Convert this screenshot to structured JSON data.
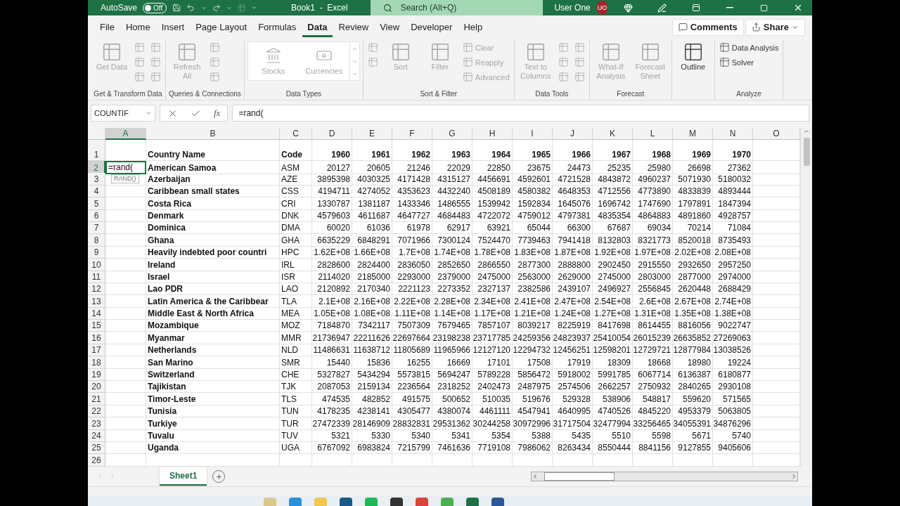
{
  "title_bar": {
    "autosave_label": "AutoSave",
    "autosave": {
      "label": "Off",
      "on": false
    },
    "title": "Book1  -  Excel",
    "search": {
      "placeholder": "Search (Alt+Q)"
    },
    "user": "User One",
    "avatar": "UO"
  },
  "menu_tabs": [
    {
      "label": "File",
      "selected": false
    },
    {
      "label": "Home",
      "selected": false
    },
    {
      "label": "Insert",
      "selected": false
    },
    {
      "label": "Page Layout",
      "selected": false
    },
    {
      "label": "Formulas",
      "selected": false
    },
    {
      "label": "Data",
      "selected": true
    },
    {
      "label": "Review",
      "selected": false
    },
    {
      "label": "View",
      "selected": false
    },
    {
      "label": "Developer",
      "selected": false
    },
    {
      "label": "Help",
      "selected": false
    }
  ],
  "comments_button": "Comments",
  "share_button": "Share",
  "ribbon": [
    {
      "name": "Get & Transform Data",
      "items": [
        {
          "kind": "large",
          "label": "Get Data",
          "disabled": true
        },
        {
          "kind": "small",
          "disabled": true
        },
        {
          "kind": "small",
          "disabled": true
        },
        {
          "kind": "small",
          "disabled": true
        },
        {
          "kind": "small",
          "disabled": true
        },
        {
          "kind": "small",
          "disabled": true
        },
        {
          "kind": "small",
          "disabled": true
        }
      ]
    },
    {
      "name": "Queries & Connections",
      "items": [
        {
          "kind": "large",
          "label": "Refresh All",
          "disabled": true
        },
        {
          "kind": "small",
          "disabled": true
        },
        {
          "kind": "small",
          "disabled": true
        },
        {
          "kind": "small",
          "disabled": true
        }
      ]
    },
    {
      "name": "Data Types",
      "items": [
        {
          "kind": "gallery",
          "options": [
            {
              "label": "Stocks",
              "disabled": true
            },
            {
              "label": "Currencies",
              "disabled": true
            }
          ]
        }
      ]
    },
    {
      "name": "Sort & Filter",
      "items": [
        {
          "kind": "small",
          "disabled": true
        },
        {
          "kind": "small",
          "disabled": true
        },
        {
          "kind": "large",
          "label": "Sort",
          "disabled": true
        },
        {
          "kind": "large",
          "label": "Filter",
          "disabled": true
        },
        {
          "kind": "small",
          "label": "Clear",
          "disabled": true
        },
        {
          "kind": "small",
          "label": "Reapply",
          "disabled": true
        },
        {
          "kind": "small",
          "label": "Advanced",
          "disabled": true
        }
      ]
    },
    {
      "name": "Data Tools",
      "items": [
        {
          "kind": "large",
          "label": "Text to Columns",
          "disabled": true
        },
        {
          "kind": "small",
          "disabled": true
        },
        {
          "kind": "small",
          "disabled": true
        },
        {
          "kind": "small",
          "disabled": true
        },
        {
          "kind": "small",
          "disabled": true
        },
        {
          "kind": "small",
          "disabled": true
        },
        {
          "kind": "small",
          "disabled": true
        }
      ]
    },
    {
      "name": "Forecast",
      "items": [
        {
          "kind": "large",
          "label": "What-If Analysis",
          "disabled": true
        },
        {
          "kind": "large",
          "label": "Forecast Sheet",
          "disabled": true
        }
      ]
    },
    {
      "items": [
        {
          "kind": "large",
          "label": "Outline",
          "disabled": false
        }
      ]
    },
    {
      "name": "Analyze",
      "items": [
        {
          "kind": "small",
          "label": "Data Analysis",
          "disabled": false
        },
        {
          "kind": "small",
          "label": "Solver",
          "disabled": false
        }
      ]
    }
  ],
  "formula_bar": {
    "name_box": "COUNTIF",
    "fx": "fx",
    "formula": "=rand("
  },
  "sheet": {
    "columns": [
      {
        "letter": "A",
        "selected": true
      },
      {
        "letter": "B",
        "selected": false
      },
      {
        "letter": "C",
        "selected": false
      },
      {
        "letter": "D",
        "selected": false
      },
      {
        "letter": "E",
        "selected": false
      },
      {
        "letter": "F",
        "selected": false
      },
      {
        "letter": "G",
        "selected": false
      },
      {
        "letter": "H",
        "selected": false
      },
      {
        "letter": "I",
        "selected": false
      },
      {
        "letter": "J",
        "selected": false
      },
      {
        "letter": "K",
        "selected": false
      },
      {
        "letter": "L",
        "selected": false
      },
      {
        "letter": "M",
        "selected": false
      },
      {
        "letter": "N",
        "selected": false
      },
      {
        "letter": "O",
        "selected": false
      }
    ],
    "header_row": {
      "number": "1",
      "selected": false,
      "name": "Country Name",
      "code": "Code",
      "years": [
        "1960",
        "1961",
        "1962",
        "1963",
        "1964",
        "1965",
        "1966",
        "1967",
        "1968",
        "1969",
        "1970"
      ]
    },
    "rows": [
      {
        "number": "2",
        "selected": true,
        "a_value": "=rand(",
        "tooltip": "RAND()",
        "name": "American Samoa",
        "code": "ASM",
        "values": [
          "20127",
          "20605",
          "21246",
          "22029",
          "22850",
          "23675",
          "24473",
          "25235",
          "25980",
          "26698",
          "27362"
        ]
      },
      {
        "number": "3",
        "selected": false,
        "name": "Azerbaijan",
        "code": "AZE",
        "values": [
          "3895398",
          "4030325",
          "4171428",
          "4315127",
          "4456691",
          "4592601",
          "4721528",
          "4843872",
          "4960237",
          "5071930",
          "5180032"
        ]
      },
      {
        "number": "4",
        "selected": false,
        "name": "Caribbean small states",
        "code": "CSS",
        "values": [
          "4194711",
          "4274052",
          "4353623",
          "4432240",
          "4508189",
          "4580382",
          "4648353",
          "4712556",
          "4773890",
          "4833839",
          "4893444"
        ]
      },
      {
        "number": "5",
        "selected": false,
        "name": "Costa Rica",
        "code": "CRI",
        "values": [
          "1330787",
          "1381187",
          "1433346",
          "1486555",
          "1539942",
          "1592834",
          "1645076",
          "1696742",
          "1747690",
          "1797891",
          "1847394"
        ]
      },
      {
        "number": "6",
        "selected": false,
        "name": "Denmark",
        "code": "DNK",
        "values": [
          "4579603",
          "4611687",
          "4647727",
          "4684483",
          "4722072",
          "4759012",
          "4797381",
          "4835354",
          "4864883",
          "4891860",
          "4928757"
        ]
      },
      {
        "number": "7",
        "selected": false,
        "name": "Dominica",
        "code": "DMA",
        "values": [
          "60020",
          "61036",
          "61978",
          "62917",
          "63921",
          "65044",
          "66300",
          "67687",
          "69034",
          "70214",
          "71084"
        ]
      },
      {
        "number": "8",
        "selected": false,
        "name": "Ghana",
        "code": "GHA",
        "values": [
          "6635229",
          "6848291",
          "7071966",
          "7300124",
          "7524470",
          "7739463",
          "7941418",
          "8132803",
          "8321773",
          "8520018",
          "8735493"
        ]
      },
      {
        "number": "9",
        "selected": false,
        "name": "Heavily indebted poor countri",
        "code": "HPC",
        "values": [
          "1.62E+08",
          "1.66E+08",
          "1.7E+08",
          "1.74E+08",
          "1.78E+08",
          "1.83E+08",
          "1.87E+08",
          "1.92E+08",
          "1.97E+08",
          "2.02E+08",
          "2.08E+08"
        ]
      },
      {
        "number": "10",
        "selected": false,
        "name": "Ireland",
        "code": "IRL",
        "values": [
          "2828600",
          "2824400",
          "2836050",
          "2852650",
          "2866550",
          "2877300",
          "2888800",
          "2902450",
          "2915550",
          "2932650",
          "2957250"
        ]
      },
      {
        "number": "11",
        "selected": false,
        "name": "Israel",
        "code": "ISR",
        "values": [
          "2114020",
          "2185000",
          "2293000",
          "2379000",
          "2475000",
          "2563000",
          "2629000",
          "2745000",
          "2803000",
          "2877000",
          "2974000"
        ]
      },
      {
        "number": "12",
        "selected": false,
        "name": "Lao PDR",
        "code": "LAO",
        "values": [
          "2120892",
          "2170340",
          "2221123",
          "2273352",
          "2327137",
          "2382586",
          "2439107",
          "2496927",
          "2556845",
          "2620448",
          "2688429"
        ]
      },
      {
        "number": "13",
        "selected": false,
        "name": "Latin America & the Caribbear",
        "code": "TLA",
        "values": [
          "2.1E+08",
          "2.16E+08",
          "2.22E+08",
          "2.28E+08",
          "2.34E+08",
          "2.41E+08",
          "2.47E+08",
          "2.54E+08",
          "2.6E+08",
          "2.67E+08",
          "2.74E+08"
        ]
      },
      {
        "number": "14",
        "selected": false,
        "name": "Middle East & North Africa",
        "code": "MEA",
        "values": [
          "1.05E+08",
          "1.08E+08",
          "1.11E+08",
          "1.14E+08",
          "1.17E+08",
          "1.21E+08",
          "1.24E+08",
          "1.27E+08",
          "1.31E+08",
          "1.35E+08",
          "1.38E+08"
        ]
      },
      {
        "number": "15",
        "selected": false,
        "name": "Mozambique",
        "code": "MOZ",
        "values": [
          "7184870",
          "7342117",
          "7507309",
          "7679465",
          "7857107",
          "8039217",
          "8225919",
          "8417698",
          "8614455",
          "8816056",
          "9022747"
        ]
      },
      {
        "number": "16",
        "selected": false,
        "name": "Myanmar",
        "code": "MMR",
        "values": [
          "21736947",
          "22211626",
          "22697664",
          "23198238",
          "23717785",
          "24259356",
          "24823937",
          "25410054",
          "26015239",
          "26635852",
          "27269063"
        ]
      },
      {
        "number": "17",
        "selected": false,
        "name": "Netherlands",
        "code": "NLD",
        "values": [
          "11486631",
          "11638712",
          "11805689",
          "11965966",
          "12127120",
          "12294732",
          "12456251",
          "12598201",
          "12729721",
          "12877984",
          "13038526"
        ]
      },
      {
        "number": "18",
        "selected": false,
        "name": "San Marino",
        "code": "SMR",
        "values": [
          "15440",
          "15836",
          "16255",
          "16669",
          "17101",
          "17508",
          "17919",
          "18309",
          "18668",
          "18980",
          "19224"
        ]
      },
      {
        "number": "19",
        "selected": false,
        "name": "Switzerland",
        "code": "CHE",
        "values": [
          "5327827",
          "5434294",
          "5573815",
          "5694247",
          "5789228",
          "5856472",
          "5918002",
          "5991785",
          "6067714",
          "6136387",
          "6180877"
        ]
      },
      {
        "number": "20",
        "selected": false,
        "name": "Tajikistan",
        "code": "TJK",
        "values": [
          "2087053",
          "2159134",
          "2236564",
          "2318252",
          "2402473",
          "2487975",
          "2574506",
          "2662257",
          "2750932",
          "2840265",
          "2930108"
        ]
      },
      {
        "number": "21",
        "selected": false,
        "name": "Timor-Leste",
        "code": "TLS",
        "values": [
          "474535",
          "482852",
          "491575",
          "500652",
          "510035",
          "519676",
          "529328",
          "538906",
          "548817",
          "559620",
          "571565"
        ]
      },
      {
        "number": "22",
        "selected": false,
        "name": "Tunisia",
        "code": "TUN",
        "values": [
          "4178235",
          "4238141",
          "4305477",
          "4380074",
          "4461111",
          "4547941",
          "4640995",
          "4740526",
          "4845220",
          "4953379",
          "5063805"
        ]
      },
      {
        "number": "23",
        "selected": false,
        "name": "Turkiye",
        "code": "TUR",
        "values": [
          "27472339",
          "28146909",
          "28832831",
          "29531362",
          "30244258",
          "30972996",
          "31717504",
          "32477994",
          "33256465",
          "34055391",
          "34876296"
        ]
      },
      {
        "number": "24",
        "selected": false,
        "name": "Tuvalu",
        "code": "TUV",
        "values": [
          "5321",
          "5330",
          "5340",
          "5341",
          "5354",
          "5388",
          "5435",
          "5510",
          "5598",
          "5671",
          "5740"
        ]
      },
      {
        "number": "25",
        "selected": false,
        "name": "Uganda",
        "code": "UGA",
        "values": [
          "6767092",
          "6983824",
          "7215799",
          "7461636",
          "7719108",
          "7986062",
          "8263434",
          "8550444",
          "8841156",
          "9127855",
          "9405606"
        ]
      },
      {
        "number": "26",
        "selected": false
      }
    ]
  },
  "sheet_tabs": [
    {
      "label": "Sheet1",
      "selected": true
    }
  ]
}
